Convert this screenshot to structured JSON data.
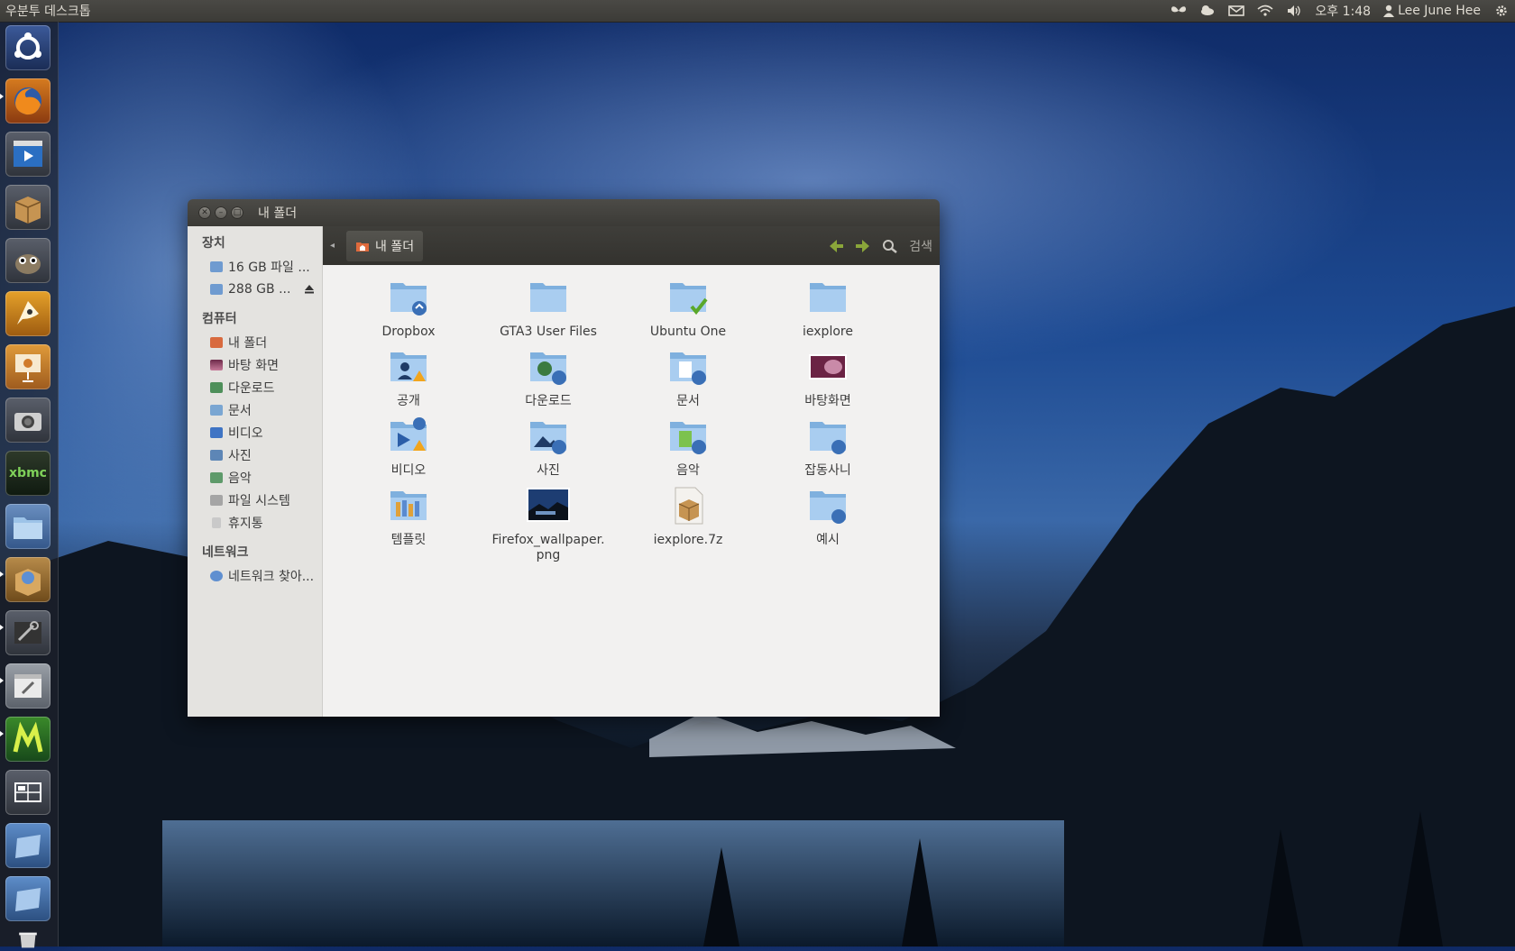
{
  "top_panel": {
    "app_title": "우분투 데스크톱",
    "clock": "오후 1:48",
    "user": "Lee June Hee",
    "tray_icons": [
      "butterfly-icon",
      "weather-icon",
      "mail-icon",
      "wifi-icon",
      "volume-icon",
      "user-icon",
      "gear-icon"
    ]
  },
  "launcher": {
    "items": [
      "ubuntu-dash-icon",
      "firefox-icon",
      "movie-player-icon",
      "archive-manager-icon",
      "gimp-icon",
      "inkscape-icon",
      "impress-icon",
      "camera-icon",
      "xbmc-icon",
      "files-icon",
      "software-center-icon",
      "system-settings-icon",
      "system-tools-icon",
      "m-app-icon",
      "workspace-switcher-icon",
      "drive-icon",
      "drive-icon-2",
      "trash-icon"
    ],
    "xbmc_label": "xbmc"
  },
  "window": {
    "title": "내 폴더",
    "toolbar": {
      "location": "내 폴더",
      "search": "검색"
    },
    "sidebar": {
      "devices_header": "장치",
      "devices": [
        "16 GB 파일 ...",
        "288 GB ..."
      ],
      "computer_header": "컴퓨터",
      "computer": [
        "내 폴더",
        "바탕 화면",
        "다운로드",
        "문서",
        "비디오",
        "사진",
        "음악",
        "파일 시스템",
        "휴지통"
      ],
      "network_header": "네트워크",
      "network": [
        "네트워크 찾아..."
      ]
    },
    "files": [
      {
        "name": "Dropbox",
        "icon": "folder-dropbox-icon"
      },
      {
        "name": "GTA3 User Files",
        "icon": "folder-icon"
      },
      {
        "name": "Ubuntu One",
        "icon": "folder-ubuntuone-icon"
      },
      {
        "name": "iexplore",
        "icon": "folder-icon"
      },
      {
        "name": "공개",
        "icon": "folder-public-icon"
      },
      {
        "name": "다운로드",
        "icon": "folder-download-icon"
      },
      {
        "name": "문서",
        "icon": "folder-documents-icon"
      },
      {
        "name": "바탕화면",
        "icon": "folder-desktop-icon"
      },
      {
        "name": "비디오",
        "icon": "folder-videos-icon"
      },
      {
        "name": "사진",
        "icon": "folder-pictures-icon"
      },
      {
        "name": "음악",
        "icon": "folder-music-icon"
      },
      {
        "name": "잡동사니",
        "icon": "folder-misc-icon"
      },
      {
        "name": "템플릿",
        "icon": "folder-templates-icon"
      },
      {
        "name": "Firefox_wallpaper.png",
        "name_line1": "Firefox_wallpaper.",
        "name_line2": "png",
        "icon": "image-thumbnail-icon"
      },
      {
        "name": "iexplore.7z",
        "icon": "archive-file-icon"
      },
      {
        "name": "예시",
        "icon": "folder-examples-icon"
      }
    ]
  }
}
